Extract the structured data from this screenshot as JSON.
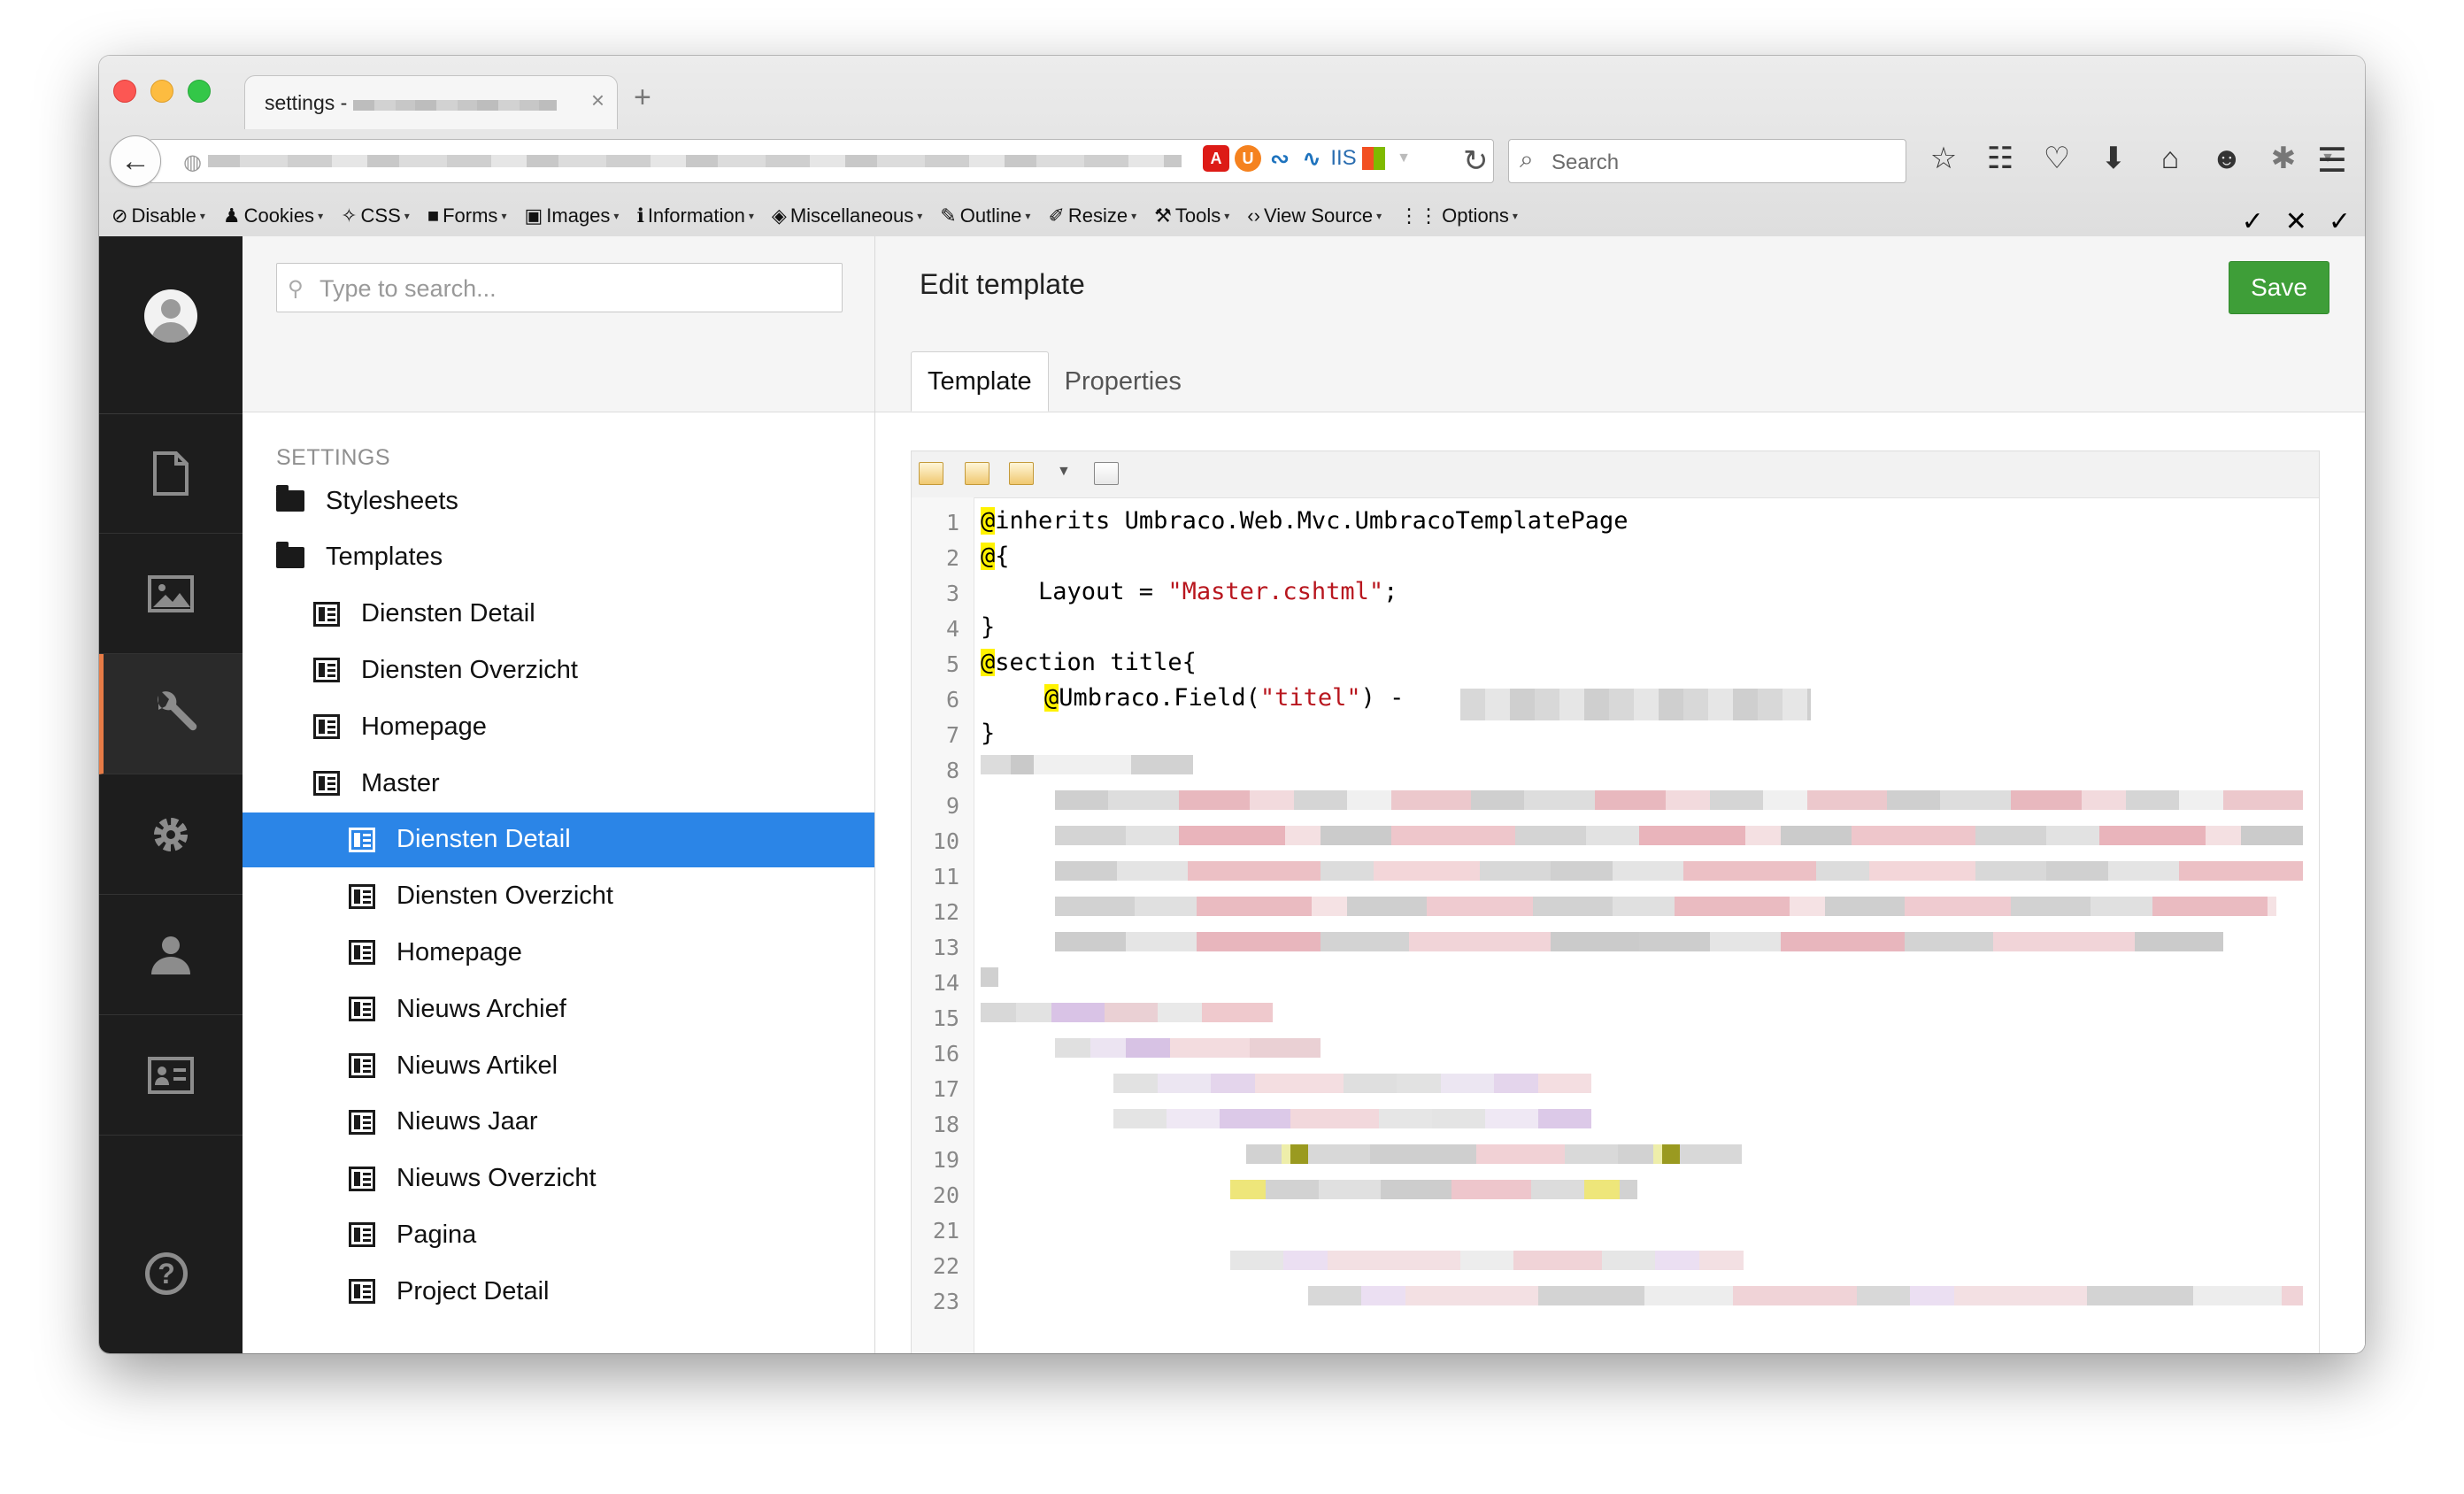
{
  "browser": {
    "tab_title": "settings -",
    "search_placeholder": "Search",
    "devtoolbar": [
      {
        "icon": "no-entry-icon",
        "glyph": "⊘",
        "label": "Disable"
      },
      {
        "icon": "person-icon",
        "glyph": "♟",
        "label": "Cookies"
      },
      {
        "icon": "wand-icon",
        "glyph": "✧",
        "label": "CSS"
      },
      {
        "icon": "briefcase-icon",
        "glyph": "■",
        "label": "Forms"
      },
      {
        "icon": "picture-icon",
        "glyph": "▣",
        "label": "Images"
      },
      {
        "icon": "info-icon",
        "glyph": "ℹ",
        "label": "Information"
      },
      {
        "icon": "cube-icon",
        "glyph": "◈",
        "label": "Miscellaneous"
      },
      {
        "icon": "pencil-icon",
        "glyph": "✎",
        "label": "Outline"
      },
      {
        "icon": "resize-pencil-icon",
        "glyph": "✐",
        "label": "Resize"
      },
      {
        "icon": "wrench-icon",
        "glyph": "⚒",
        "label": "Tools"
      },
      {
        "icon": "code-icon",
        "glyph": "‹›",
        "label": "View Source"
      },
      {
        "icon": "sliders-icon",
        "glyph": "⋮⋮",
        "label": "Options"
      }
    ],
    "devtoolbar_right": [
      "✓",
      "✕",
      "✓"
    ]
  },
  "sidebar": {
    "search_placeholder": "Type to search...",
    "section_label": "SETTINGS",
    "tree": [
      {
        "label": "Stylesheets",
        "type": "folder",
        "depth": 0,
        "selected": false
      },
      {
        "label": "Templates",
        "type": "folder",
        "depth": 0,
        "selected": false
      },
      {
        "label": "Diensten Detail",
        "type": "template",
        "depth": 1,
        "selected": false
      },
      {
        "label": "Diensten Overzicht",
        "type": "template",
        "depth": 1,
        "selected": false
      },
      {
        "label": "Homepage",
        "type": "template",
        "depth": 1,
        "selected": false
      },
      {
        "label": "Master",
        "type": "template",
        "depth": 1,
        "selected": false
      },
      {
        "label": "Diensten Detail",
        "type": "template",
        "depth": 2,
        "selected": true
      },
      {
        "label": "Diensten Overzicht",
        "type": "template",
        "depth": 2,
        "selected": false
      },
      {
        "label": "Homepage",
        "type": "template",
        "depth": 2,
        "selected": false
      },
      {
        "label": "Nieuws Archief",
        "type": "template",
        "depth": 2,
        "selected": false
      },
      {
        "label": "Nieuws Artikel",
        "type": "template",
        "depth": 2,
        "selected": false
      },
      {
        "label": "Nieuws Jaar",
        "type": "template",
        "depth": 2,
        "selected": false
      },
      {
        "label": "Nieuws Overzicht",
        "type": "template",
        "depth": 2,
        "selected": false
      },
      {
        "label": "Pagina",
        "type": "template",
        "depth": 2,
        "selected": false
      },
      {
        "label": "Project Detail",
        "type": "template",
        "depth": 2,
        "selected": false
      }
    ]
  },
  "editor": {
    "title": "Edit template",
    "save_label": "Save",
    "tabs": [
      "Template",
      "Properties"
    ],
    "active_tab": "Template",
    "line_numbers": [
      "1",
      "2",
      "3",
      "4",
      "5",
      "6",
      "7",
      "8",
      "9",
      "10",
      "11",
      "12",
      "13",
      "14",
      "15",
      "16",
      "17",
      "18",
      "19",
      "20",
      "21",
      "22",
      "23"
    ],
    "code": {
      "l1": "inherits Umbraco.Web.Mvc.UmbracoTemplatePage",
      "l2": "{",
      "l3_pre": "    Layout = ",
      "l3_str": "\"Master.cshtml\"",
      "l3_post": ";",
      "l4": "}",
      "l5": "section title{",
      "l6_pre": "Umbraco.Field(",
      "l6_str": "\"titel\"",
      "l6_post": ") -",
      "l7": "}"
    }
  },
  "colors": {
    "accent": "#2b85e7",
    "save": "#3e9e38",
    "nav_active": "#e77b46",
    "string": "#b8161e",
    "razor_highlight": "#fff200"
  }
}
